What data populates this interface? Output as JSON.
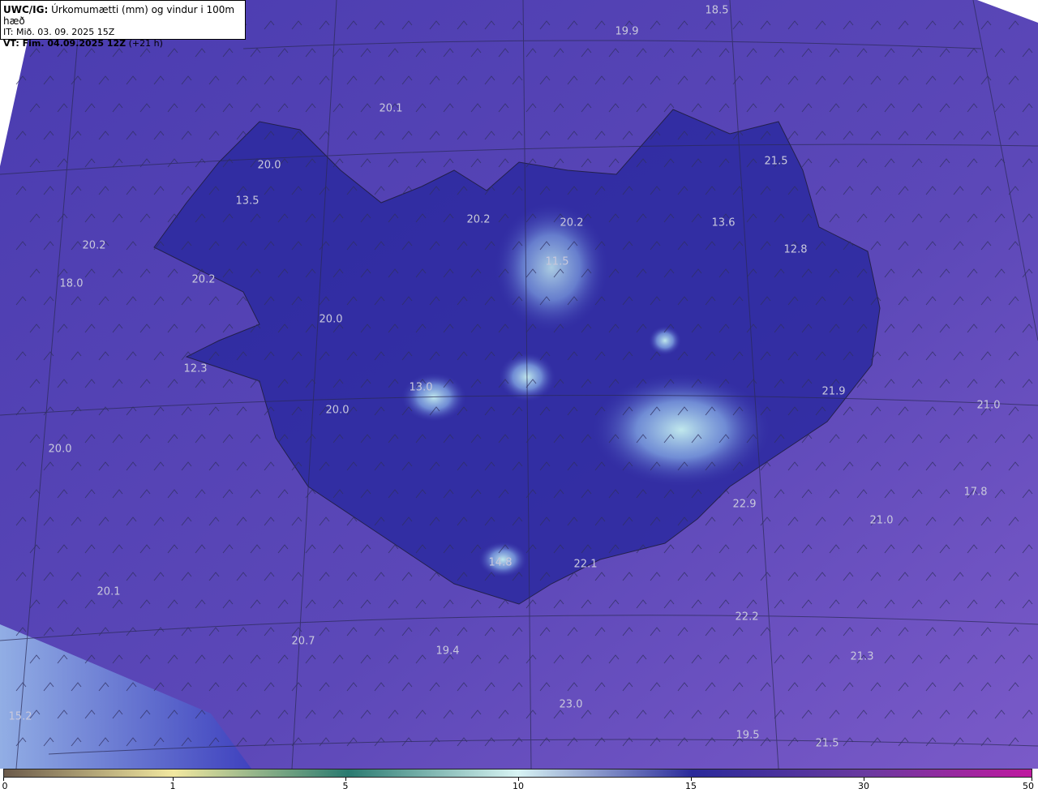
{
  "header": {
    "prefix": "UWC/IG:",
    "title": "Úrkomumætti (mm) og vindur i 100m hæð",
    "it": "IT: Mið. 03. 09. 2025 15Z",
    "vt_label": "VT: Fim. 04.09.2025 12Z",
    "vt_offset": "(+21 h)"
  },
  "map_labels": [
    "18.5",
    "19.9",
    "20.1",
    "20.0",
    "13.5",
    "20.2",
    "18.0",
    "20.2",
    "20.0",
    "12.3",
    "13.0",
    "20.0",
    "20.0",
    "20.2",
    "20.2",
    "11.5",
    "13.6",
    "21.5",
    "12.8",
    "21.9",
    "21.0",
    "17.8",
    "22.9",
    "21.0",
    "14.8",
    "22.1",
    "22.2",
    "21.3",
    "20.1",
    "20.7",
    "19.4",
    "23.0",
    "15.2",
    "19.5",
    "21.5"
  ],
  "colorbar": {
    "ticks": [
      "0",
      "1",
      "5",
      "10",
      "15",
      "30",
      "50"
    ],
    "colors": [
      "#6b5a4a",
      "#f2e8a0",
      "#2a7a70",
      "#d8f4f4",
      "#2a2a9a",
      "#6a3aa0",
      "#c01aa0"
    ]
  }
}
